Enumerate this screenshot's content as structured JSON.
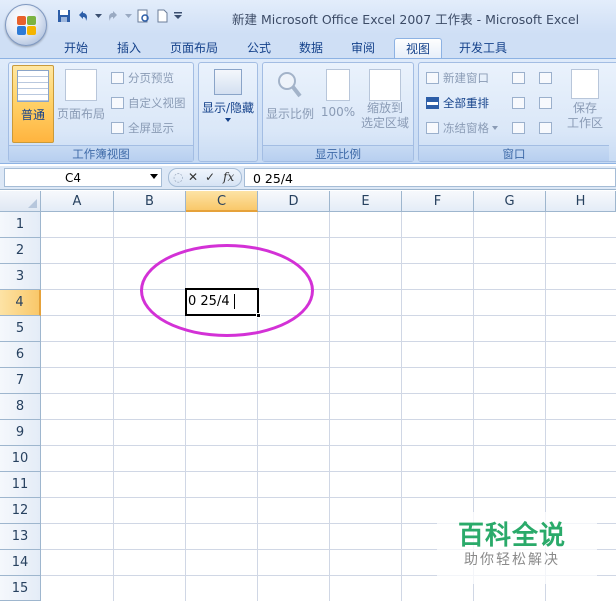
{
  "window": {
    "title": "新建 Microsoft Office Excel 2007 工作表 - Microsoft Excel"
  },
  "quick_access": {
    "icons": [
      "save-icon",
      "undo-icon",
      "redo-icon",
      "print-preview-icon",
      "new-document-icon",
      "customize-icon"
    ]
  },
  "tabs": [
    "开始",
    "插入",
    "页面布局",
    "公式",
    "数据",
    "审阅",
    "视图",
    "开发工具"
  ],
  "active_tab": "视图",
  "ribbon": {
    "workbook_views": {
      "label": "工作簿视图",
      "normal": "普通",
      "page_layout": "页面布局",
      "page_break_preview": "分页预览",
      "custom_views": "自定义视图",
      "full_screen": "全屏显示"
    },
    "show_hide": {
      "label": "显示/隐藏"
    },
    "zoom": {
      "label": "显示比例",
      "zoom": "显示比例",
      "hundred": "100%",
      "zoom_to_selection": "缩放到\n选定区域",
      "zoom_to_selection_l1": "缩放到",
      "zoom_to_selection_l2": "选定区域"
    },
    "window": {
      "label": "窗口",
      "new_window": "新建窗口",
      "arrange_all": "全部重排",
      "freeze_panes": "冻结窗格",
      "save_workspace_l1": "保存",
      "save_workspace_l2": "工作区"
    }
  },
  "formula_bar": {
    "name_box": "C4",
    "fx": "fx",
    "content": "0 25/4"
  },
  "grid": {
    "columns": [
      "A",
      "B",
      "C",
      "D",
      "E",
      "F",
      "G",
      "H"
    ],
    "rows": [
      "1",
      "2",
      "3",
      "4",
      "5",
      "6",
      "7",
      "8",
      "9",
      "10",
      "11",
      "12",
      "13",
      "14",
      "15"
    ],
    "selected_column": "C",
    "selected_row": "4",
    "active_cell_value": "0 25/4"
  },
  "annotation": {
    "color": "#d331d6"
  },
  "watermark": {
    "line1": "百科全说",
    "line2": "助你轻松解决"
  }
}
